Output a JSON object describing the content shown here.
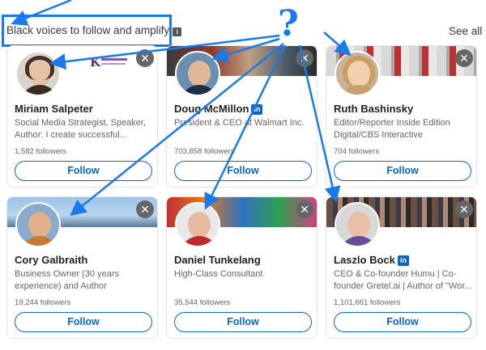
{
  "section": {
    "title": "Black voices to follow and amplify",
    "info_icon": "info-icon",
    "see_all_label": "See all"
  },
  "annotation": {
    "question_mark": "?",
    "color": "#1a7ae8"
  },
  "cards": [
    {
      "name": "Miriam Salpeter",
      "verified": false,
      "headline": "Social Media Strategist, Speaker, Author: I create successful...",
      "followers": "1,582 followers",
      "follow_label": "Follow",
      "close_icon": "✕",
      "logo_text": "K Keppie Careers"
    },
    {
      "name": "Doug McMillon",
      "verified": true,
      "badge": "in",
      "headline": "President & CEO at Walmart Inc.",
      "followers": "703,858 followers",
      "follow_label": "Follow",
      "close_icon": "✕"
    },
    {
      "name": "Ruth Bashinsky",
      "verified": false,
      "headline": "Editor/Reporter Inside Edition Digital/CBS Interactive",
      "followers": "704 followers",
      "follow_label": "Follow",
      "close_icon": "✕"
    },
    {
      "name": "Cory Galbraith",
      "verified": false,
      "headline": "Business Owner (30 years experience) and Author",
      "followers": "19,244 followers",
      "follow_label": "Follow",
      "close_icon": "✕"
    },
    {
      "name": "Daniel Tunkelang",
      "verified": false,
      "headline": "High-Class Consultant",
      "followers": "35,544 followers",
      "follow_label": "Follow",
      "close_icon": "✕"
    },
    {
      "name": "Laszlo Bock",
      "verified": true,
      "badge": "in",
      "headline": "CEO & Co-founder Humu | Co-founder Gretel.ai | Author of \"Wor...",
      "followers": "1,101,661 followers",
      "follow_label": "Follow",
      "close_icon": "✕"
    }
  ],
  "colors": {
    "accent": "#0a66c2",
    "annotation": "#1a7ae8"
  }
}
